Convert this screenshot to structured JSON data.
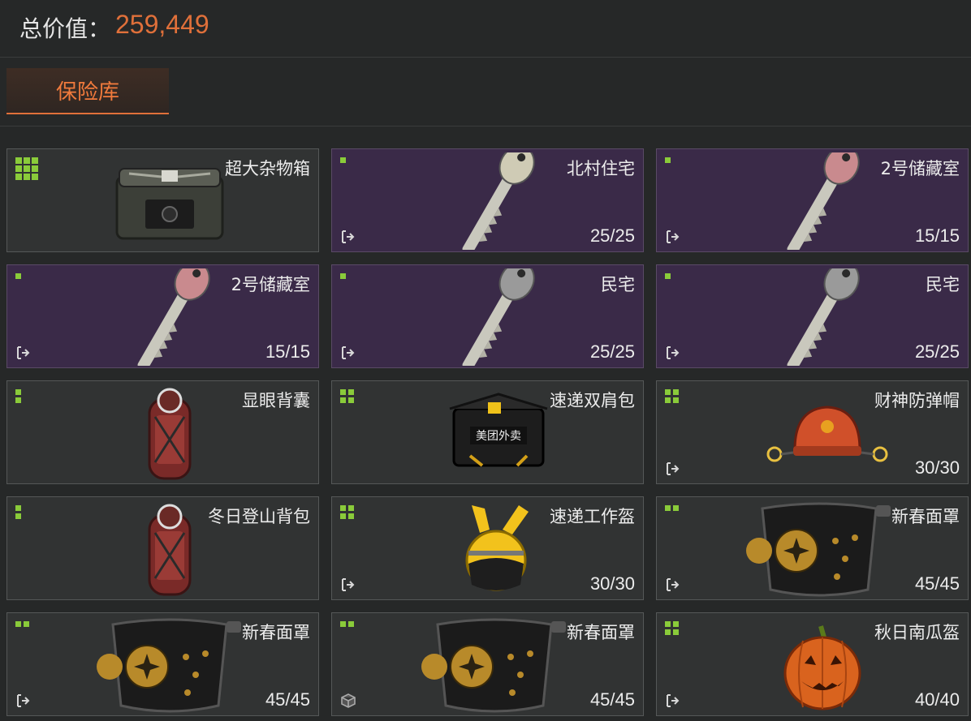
{
  "header": {
    "total_label": "总价值：",
    "total_value": "259,449"
  },
  "tabs": [
    {
      "label": "保险库"
    }
  ],
  "items": [
    {
      "name": "超大杂物箱",
      "count": "",
      "size": "3x3",
      "icon": "crate-icon",
      "purple": false,
      "action": ""
    },
    {
      "name": "北村住宅",
      "count": "25/25",
      "size": "1x1",
      "icon": "key-icon",
      "purple": true,
      "action": "move-icon"
    },
    {
      "name": "2号储藏室",
      "count": "15/15",
      "size": "1x1",
      "icon": "key-icon",
      "purple": true,
      "action": "move-icon"
    },
    {
      "name": "2号储藏室",
      "count": "15/15",
      "size": "1x1",
      "icon": "key-icon",
      "purple": true,
      "action": "move-icon"
    },
    {
      "name": "民宅",
      "count": "25/25",
      "size": "1x1",
      "icon": "key-icon",
      "purple": true,
      "action": "move-icon"
    },
    {
      "name": "民宅",
      "count": "25/25",
      "size": "1x1",
      "icon": "key-icon",
      "purple": true,
      "action": "move-icon"
    },
    {
      "name": "显眼背囊",
      "count": "",
      "size": "1x2",
      "icon": "backpack-icon",
      "purple": false,
      "action": ""
    },
    {
      "name": "速递双肩包",
      "count": "",
      "size": "2x2",
      "icon": "delivery-bag-icon",
      "purple": false,
      "action": ""
    },
    {
      "name": "财神防弹帽",
      "count": "30/30",
      "size": "2x2",
      "icon": "hat-icon",
      "purple": false,
      "action": "move-icon"
    },
    {
      "name": "冬日登山背包",
      "count": "",
      "size": "1x2",
      "icon": "backpack-icon",
      "purple": false,
      "action": ""
    },
    {
      "name": "速递工作盔",
      "count": "30/30",
      "size": "2x2",
      "icon": "helmet-icon",
      "purple": false,
      "action": "move-icon"
    },
    {
      "name": "新春面罩",
      "count": "45/45",
      "size": "2x1",
      "icon": "face-shield-icon",
      "purple": false,
      "action": "move-icon"
    },
    {
      "name": "新春面罩",
      "count": "45/45",
      "size": "2x1",
      "icon": "face-shield-icon",
      "purple": false,
      "action": "move-icon"
    },
    {
      "name": "新春面罩",
      "count": "45/45",
      "size": "2x1",
      "icon": "face-shield-icon",
      "purple": false,
      "action": "box-icon"
    },
    {
      "name": "秋日南瓜盔",
      "count": "40/40",
      "size": "2x2",
      "icon": "pumpkin-icon",
      "purple": false,
      "action": "move-icon"
    }
  ],
  "colors": {
    "accent": "#e0703a",
    "size_indicator": "#8acb3a",
    "rare_card": "#3a2a48"
  }
}
